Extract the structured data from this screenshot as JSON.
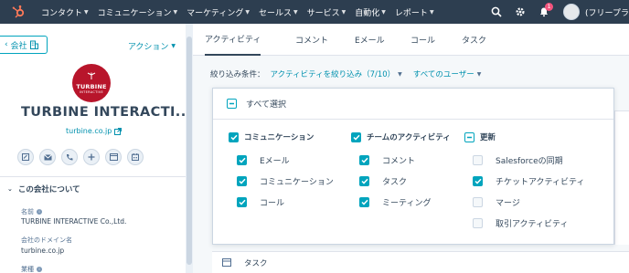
{
  "nav": {
    "items": [
      {
        "label": "コンタクト"
      },
      {
        "label": "コミュニケーション"
      },
      {
        "label": "マーケティング"
      },
      {
        "label": "セールス"
      },
      {
        "label": "サービス"
      },
      {
        "label": "自動化"
      },
      {
        "label": "レポート"
      }
    ],
    "notification_count": "1",
    "user_label": "(フリープラ"
  },
  "record": {
    "back_label": "会社",
    "actions_label": "アクション",
    "logo_line1": "TURBINE",
    "logo_line2": "INTERACTIVE",
    "name": "TURBINE INTERACTI...",
    "domain": "turbine.co.jp",
    "about_heading": "この会社について",
    "properties": [
      {
        "label": "名前",
        "value": "TURBINE INTERACTIVE Co.,Ltd."
      },
      {
        "label": "会社のドメイン名",
        "value": "turbine.co.jp"
      },
      {
        "label": "業種",
        "value": ""
      }
    ]
  },
  "tabs": [
    {
      "label": "アクティビティ",
      "active": true
    },
    {
      "label": "コメント",
      "active": false
    },
    {
      "label": "Eメール",
      "active": false
    },
    {
      "label": "コール",
      "active": false
    },
    {
      "label": "タスク",
      "active": false
    }
  ],
  "filter": {
    "label": "絞り込み条件：",
    "activity_filter": "アクティビティを絞り込み（7/10）",
    "users_filter": "すべてのユーザー"
  },
  "dropdown": {
    "select_all": "すべて選択",
    "groups": [
      {
        "label": "コミュニケーション",
        "options": [
          {
            "label": "Eメール",
            "checked": true
          },
          {
            "label": "コミュニケーション",
            "checked": true
          },
          {
            "label": "コール",
            "checked": true
          }
        ]
      },
      {
        "label": "チームのアクティビティ",
        "options": [
          {
            "label": "コメント",
            "checked": true
          },
          {
            "label": "タスク",
            "checked": true
          },
          {
            "label": "ミーティング",
            "checked": true
          }
        ]
      },
      {
        "label": "更新",
        "options": [
          {
            "label": "Salesforceの同期",
            "checked": false
          },
          {
            "label": "チケットアクティビティ",
            "checked": true
          },
          {
            "label": "マージ",
            "checked": false
          },
          {
            "label": "取引アクティビティ",
            "checked": false
          }
        ]
      }
    ]
  },
  "timeline": {
    "task_label": "タスク"
  },
  "colors": {
    "nav_bg": "#2d3e50",
    "accent": "#00a4bd",
    "link": "#0091ae",
    "logo_bg": "#b8152b",
    "hubspot_orange": "#ff7a59",
    "badge": "#f2547d"
  },
  "icons": {
    "logo": "hubspot-sprocket-icon",
    "search": "search-icon",
    "settings": "gear-icon",
    "notifications": "bell-icon"
  }
}
